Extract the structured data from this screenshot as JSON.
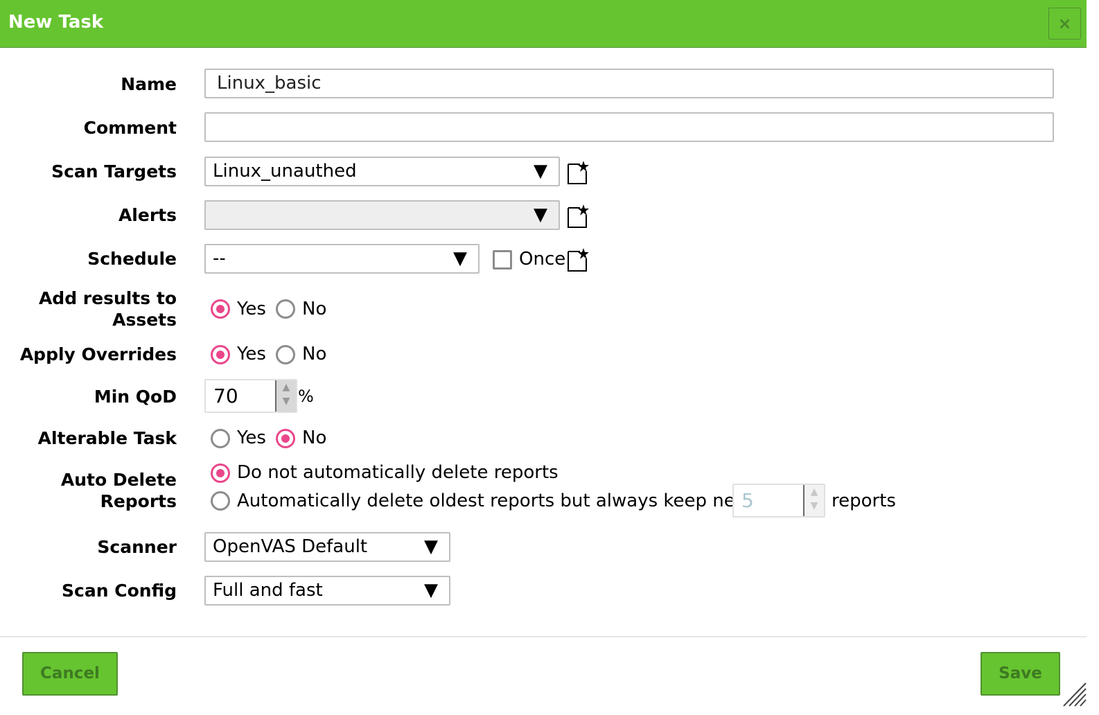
{
  "dialog": {
    "title": "New Task",
    "close_label": "×"
  },
  "fields": {
    "name": {
      "label": "Name",
      "value": "Linux_basic"
    },
    "comment": {
      "label": "Comment",
      "value": ""
    },
    "scan_targets": {
      "label": "Scan Targets",
      "value": "Linux_unauthed"
    },
    "alerts": {
      "label": "Alerts",
      "value": ""
    },
    "schedule": {
      "label": "Schedule",
      "value": "--",
      "once_label": "Once",
      "once_checked": false
    },
    "add_results": {
      "label_line1": "Add results to",
      "label_line2": "Assets",
      "yes": "Yes",
      "no": "No",
      "selected": "Yes"
    },
    "apply_overrides": {
      "label": "Apply Overrides",
      "yes": "Yes",
      "no": "No",
      "selected": "Yes"
    },
    "min_qod": {
      "label": "Min QoD",
      "value": "70",
      "unit": "%"
    },
    "alterable_task": {
      "label": "Alterable Task",
      "yes": "Yes",
      "no": "No",
      "selected": "No"
    },
    "auto_delete": {
      "label_line1": "Auto Delete",
      "label_line2": "Reports",
      "option_keep": "Do not automatically delete reports",
      "option_delete": "Automatically delete oldest reports but always keep newest",
      "keep_count": "5",
      "suffix": "reports",
      "selected": "keep"
    },
    "scanner": {
      "label": "Scanner",
      "value": "OpenVAS Default"
    },
    "scan_config": {
      "label": "Scan Config",
      "value": "Full and fast"
    }
  },
  "arrow_glyph": "▼",
  "footer": {
    "cancel_label": "Cancel",
    "save_label": "Save"
  },
  "colors": {
    "header_green": "#66c430",
    "radio_pink": "#e9478a"
  }
}
